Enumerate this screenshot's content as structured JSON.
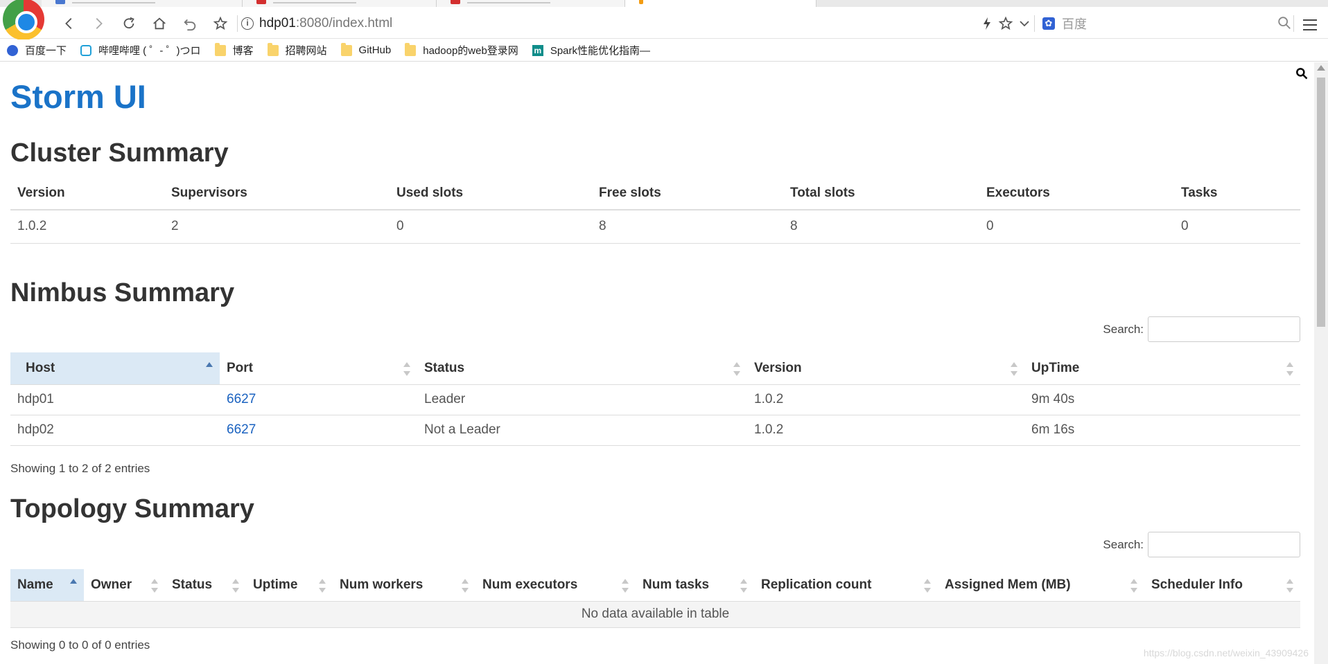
{
  "browser": {
    "url_host": "hdp01",
    "url_rest": ":8080/index.html",
    "search_placeholder": "百度"
  },
  "bookmarks": [
    {
      "label": "百度一下",
      "icon": "paw-icon"
    },
    {
      "label": "哔哩哔哩 ( ゜- ゜)つロ",
      "icon": "tv-icon"
    },
    {
      "label": "博客",
      "icon": "folder-icon"
    },
    {
      "label": "招聘网站",
      "icon": "folder-icon"
    },
    {
      "label": "GitHub",
      "icon": "folder-icon"
    },
    {
      "label": "hadoop的web登录网",
      "icon": "folder-icon"
    },
    {
      "label": "Spark性能优化指南—",
      "icon": "m-icon"
    }
  ],
  "page": {
    "title": "Storm UI",
    "cluster": {
      "heading": "Cluster Summary",
      "headers": [
        "Version",
        "Supervisors",
        "Used slots",
        "Free slots",
        "Total slots",
        "Executors",
        "Tasks"
      ],
      "values": [
        "1.0.2",
        "2",
        "0",
        "8",
        "8",
        "0",
        "0"
      ]
    },
    "nimbus": {
      "heading": "Nimbus Summary",
      "search_label": "Search:",
      "headers": [
        "Host",
        "Port",
        "Status",
        "Version",
        "UpTime"
      ],
      "rows": [
        [
          "hdp01",
          "6627",
          "Leader",
          "1.0.2",
          "9m 40s"
        ],
        [
          "hdp02",
          "6627",
          "Not a Leader",
          "1.0.2",
          "6m 16s"
        ]
      ],
      "info": "Showing 1 to 2 of 2 entries"
    },
    "topology": {
      "heading": "Topology Summary",
      "search_label": "Search:",
      "headers": [
        "Name",
        "Owner",
        "Status",
        "Uptime",
        "Num workers",
        "Num executors",
        "Num tasks",
        "Replication count",
        "Assigned Mem (MB)",
        "Scheduler Info"
      ],
      "empty": "No data available in table",
      "info": "Showing 0 to 0 of 0 entries"
    },
    "watermark": "https://blog.csdn.net/weixin_43909426"
  },
  "colors": {
    "title": "#1a73c8",
    "sorted_header": "#dbe9f5",
    "link": "#1a62c0"
  }
}
